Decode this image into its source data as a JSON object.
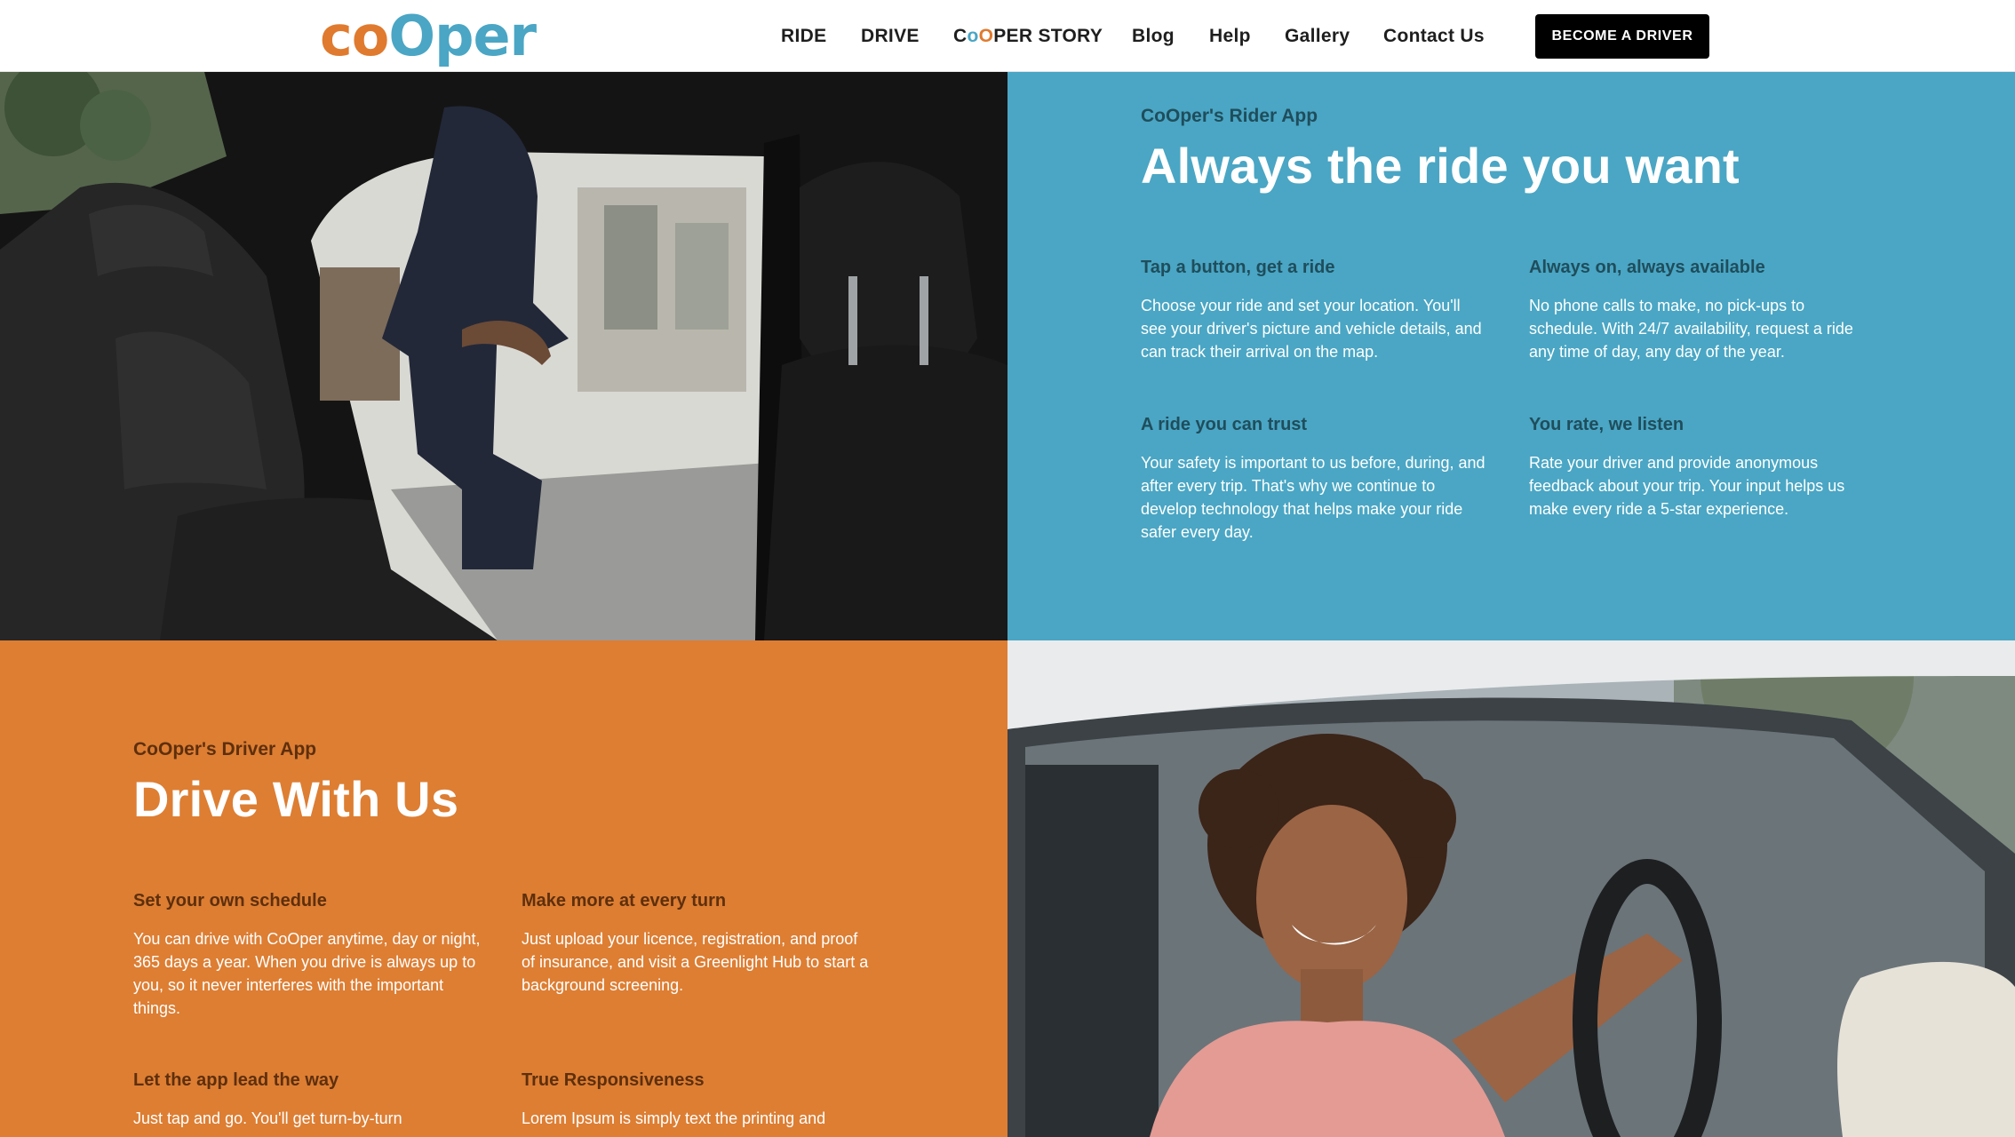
{
  "brand": {
    "logo_part1": "co",
    "logo_part2": "O",
    "logo_part3": "per",
    "primary_orange": "#dd7e33",
    "primary_blue": "#4aa6c4"
  },
  "nav": {
    "items": [
      {
        "label": "RIDE"
      },
      {
        "label": "DRIVE"
      },
      {
        "label_c": "C",
        "label_o1": "o",
        "label_o2": "O",
        "label_rest": "PER STORY"
      },
      {
        "label": "Blog"
      },
      {
        "label": "Help"
      },
      {
        "label": "Gallery"
      },
      {
        "label": "Contact Us"
      }
    ],
    "cta_label": "BECOME A DRIVER"
  },
  "rider_section": {
    "eyebrow": "CoOper's Rider App",
    "headline": "Always the ride you want",
    "features": [
      {
        "title": "Tap a button, get a ride",
        "body": "Choose your ride and set your location. You'll see your driver's picture and vehicle details, and can track their arrival on the map."
      },
      {
        "title": "Always on, always available",
        "body": "No phone calls to make, no pick-ups to schedule. With 24/7 availability, request a ride any time of day, any day of the year."
      },
      {
        "title": "A ride you can trust",
        "body": "Your safety is important to us before, during, and after every trip. That's why we continue to develop technology that helps make your ride safer every day."
      },
      {
        "title": "You rate, we listen",
        "body": "Rate your driver and provide anonymous feedback about your trip. Your input helps us make every ride a 5-star experience."
      }
    ]
  },
  "driver_section": {
    "eyebrow": "CoOper's Driver App",
    "headline": "Drive With Us",
    "features": [
      {
        "title": "Set your own schedule",
        "body": "You can drive with CoOper anytime, day or night, 365 days a year. When you drive is always up to you, so it never interferes with the important things."
      },
      {
        "title": "Make more at every turn",
        "body": "Just upload your licence, registration, and proof of insurance, and visit a Greenlight Hub to start a background screening."
      },
      {
        "title": "Let the app lead the way",
        "body": "Just tap and go. You'll get turn-by-turn"
      },
      {
        "title": "True Responsiveness",
        "body": "Lorem Ipsum is simply text the printing and"
      }
    ]
  }
}
